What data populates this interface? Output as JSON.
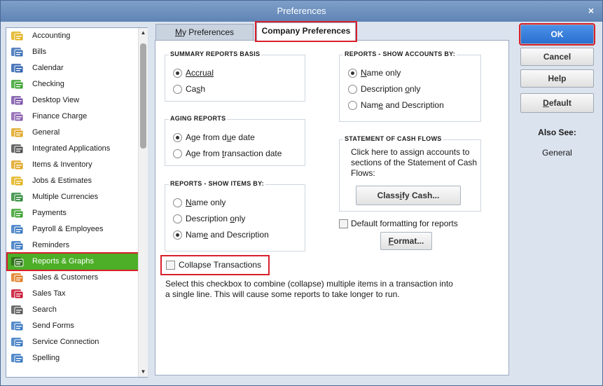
{
  "window": {
    "title": "Preferences",
    "close_glyph": "×"
  },
  "sidebar": {
    "items": [
      {
        "label": "Accounting",
        "icon": "accounting-icon",
        "color": "#e2b21b"
      },
      {
        "label": "Bills",
        "icon": "bills-icon",
        "color": "#3b6fb6"
      },
      {
        "label": "Calendar",
        "icon": "calendar-icon",
        "color": "#2f62b0"
      },
      {
        "label": "Checking",
        "icon": "checking-icon",
        "color": "#3aa12e"
      },
      {
        "label": "Desktop View",
        "icon": "desktop-view-icon",
        "color": "#7a52a8"
      },
      {
        "label": "Finance Charge",
        "icon": "finance-charge-icon",
        "color": "#8a5fb0"
      },
      {
        "label": "General",
        "icon": "general-icon",
        "color": "#e0a520"
      },
      {
        "label": "Integrated Applications",
        "icon": "integrated-apps-icon",
        "color": "#4d4d4d"
      },
      {
        "label": "Items & Inventory",
        "icon": "items-inventory-icon",
        "color": "#e0a520"
      },
      {
        "label": "Jobs & Estimates",
        "icon": "jobs-estimates-icon",
        "color": "#e2b21b"
      },
      {
        "label": "Multiple Currencies",
        "icon": "multiple-currencies-icon",
        "color": "#2e8b3a"
      },
      {
        "label": "Payments",
        "icon": "payments-icon",
        "color": "#3aa12e"
      },
      {
        "label": "Payroll & Employees",
        "icon": "payroll-employees-icon",
        "color": "#3a78c2"
      },
      {
        "label": "Reminders",
        "icon": "reminders-icon",
        "color": "#3a78c2"
      },
      {
        "label": "Reports & Graphs",
        "icon": "reports-graphs-icon",
        "color": "#2e7d32",
        "selected": true
      },
      {
        "label": "Sales & Customers",
        "icon": "sales-customers-icon",
        "color": "#e07a1f"
      },
      {
        "label": "Sales Tax",
        "icon": "sales-tax-icon",
        "color": "#c8102e"
      },
      {
        "label": "Search",
        "icon": "search-icon",
        "color": "#555555"
      },
      {
        "label": "Send Forms",
        "icon": "send-forms-icon",
        "color": "#3a78c2"
      },
      {
        "label": "Service Connection",
        "icon": "service-connection-icon",
        "color": "#3a78c2"
      },
      {
        "label": "Spelling",
        "icon": "spelling-icon",
        "color": "#3a78c2"
      }
    ]
  },
  "tabs": {
    "my": {
      "label_prefix": "M",
      "label_rest": "y Preferences"
    },
    "company": {
      "label": "Company Preferences"
    }
  },
  "summary_basis": {
    "title": "SUMMARY REPORTS BASIS",
    "accrual": "Accrual",
    "cash_prefix": "Ca",
    "cash_key": "s",
    "cash_rest": "h",
    "selected": "Accrual"
  },
  "aging": {
    "title": "AGING REPORTS",
    "due_prefix": "Age from d",
    "due_key": "u",
    "due_rest": "e date",
    "trans_prefix": "Age from ",
    "trans_key": "t",
    "trans_rest": "ransaction date",
    "selected": "Age from due date"
  },
  "items_by": {
    "title": "REPORTS - SHOW ITEMS BY:",
    "name_prefix": "",
    "name_key": "N",
    "name_rest": "ame only",
    "desc_prefix": "Description ",
    "desc_key": "o",
    "desc_rest": "nly",
    "namedesc_prefix": "Nam",
    "namedesc_key": "e",
    "namedesc_rest": " and Description",
    "selected": "Name and Description"
  },
  "accounts_by": {
    "title": "REPORTS -  SHOW ACCOUNTS BY:",
    "name_prefix": "",
    "name_key": "N",
    "name_rest": "ame only",
    "desc_prefix": "Description ",
    "desc_key": "o",
    "desc_rest": "nly",
    "namedesc_prefix": "Nam",
    "namedesc_key": "e",
    "namedesc_rest": " and Description",
    "selected": "Name only"
  },
  "cash_flows": {
    "title": "STATEMENT OF CASH FLOWS",
    "desc": "Click here to assign accounts to sections of the Statement of Cash Flows:",
    "btn_prefix": "Class",
    "btn_key": "i",
    "btn_rest": "fy Cash..."
  },
  "default_formatting": {
    "label": "Default formatting for reports",
    "checked": false
  },
  "format_btn": {
    "prefix": "",
    "key": "F",
    "rest": "ormat..."
  },
  "collapse": {
    "label": "Collapse Transactions",
    "checked": false,
    "help": "Select this checkbox to combine (collapse) multiple items in a transaction into a single line. This will cause some reports to take longer to run."
  },
  "buttons": {
    "ok": "OK",
    "cancel": "Cancel",
    "help": "Help",
    "default_prefix": "",
    "default_key": "D",
    "default_rest": "efault"
  },
  "also_see": {
    "title": "Also See:",
    "link": "General"
  },
  "colors": {
    "accent": "#2a6fd0",
    "highlight_box": "#d8202c",
    "selected_item": "#4caf27"
  }
}
